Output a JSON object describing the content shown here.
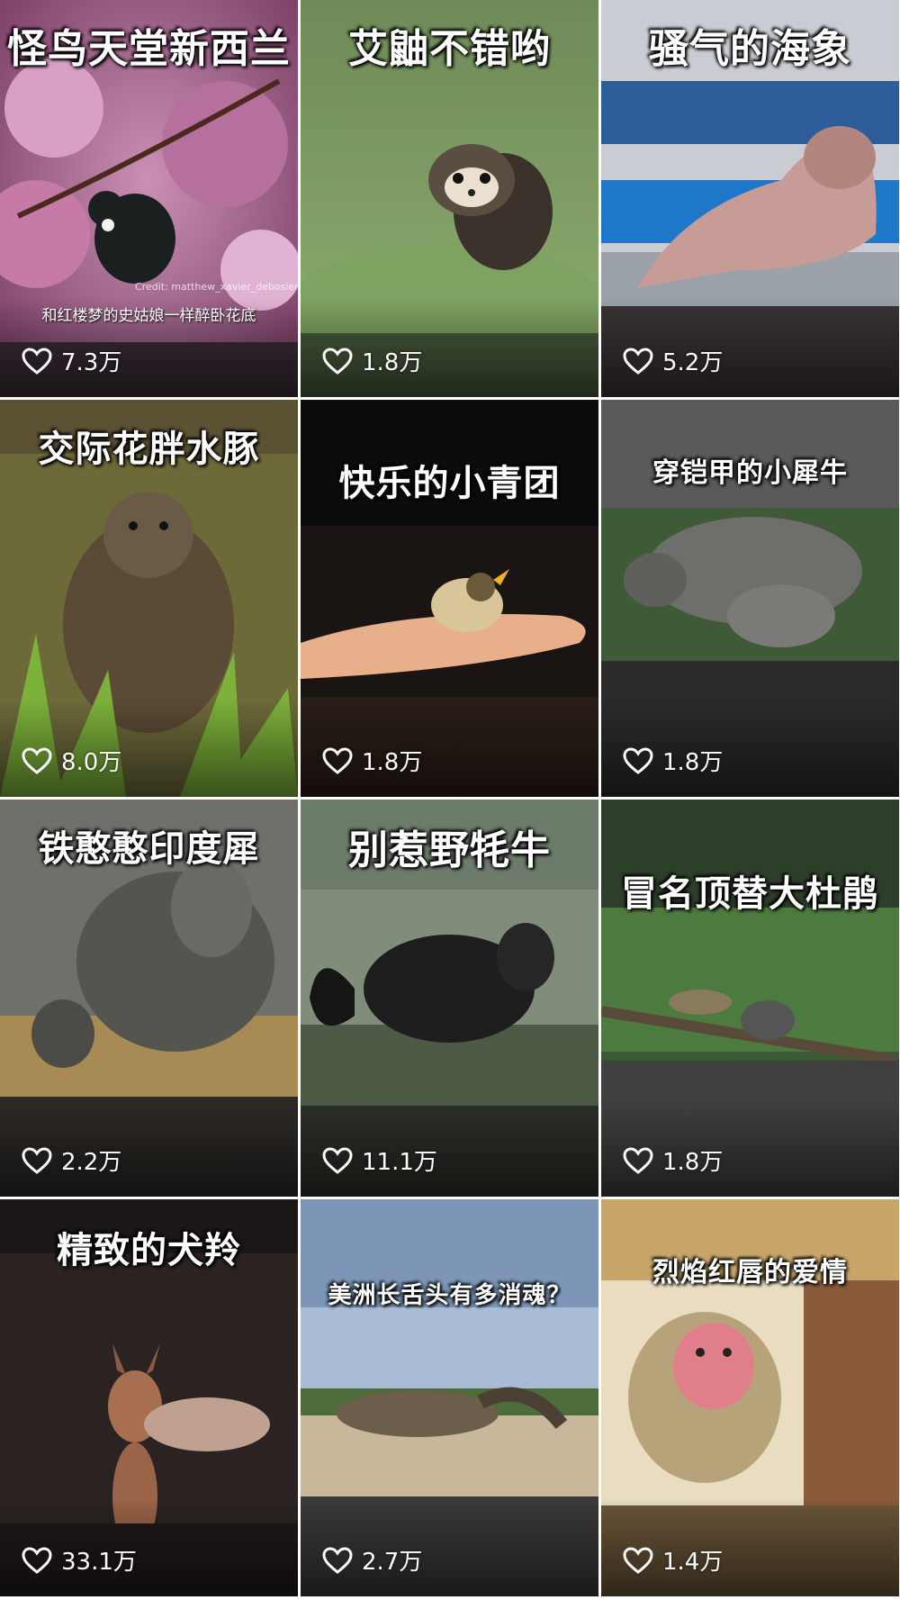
{
  "feed": {
    "items": [
      {
        "title": "怪鸟天堂新西兰",
        "subtitle": "和红楼梦的史姑娘一样醉卧花底",
        "credit": "Credit: matthew_xavier_debosiers",
        "likes": "7.3万"
      },
      {
        "title": "艾鼬不错哟",
        "likes": "1.8万"
      },
      {
        "title": "骚气的海象",
        "likes": "5.2万"
      },
      {
        "title": "交际花胖水豚",
        "likes": "8.0万"
      },
      {
        "title": "快乐的小青团",
        "likes": "1.8万"
      },
      {
        "title": "穿铠甲的小犀牛",
        "likes": "1.8万"
      },
      {
        "title": "铁憨憨印度犀",
        "likes": "2.2万"
      },
      {
        "title": "别惹野牦牛",
        "likes": "11.1万"
      },
      {
        "title": "冒名顶替大杜鹃",
        "likes": "1.8万"
      },
      {
        "title": "精致的犬羚",
        "likes": "33.1万"
      },
      {
        "title": "美洲长舌头有多消魂？",
        "likes": "2.7万"
      },
      {
        "title": "烈焰红唇的爱情",
        "likes": "1.4万"
      }
    ]
  },
  "colors": {
    "background": "#ffffff",
    "text": "#ffffff"
  },
  "icons": {
    "like": "heart-outline-icon"
  }
}
